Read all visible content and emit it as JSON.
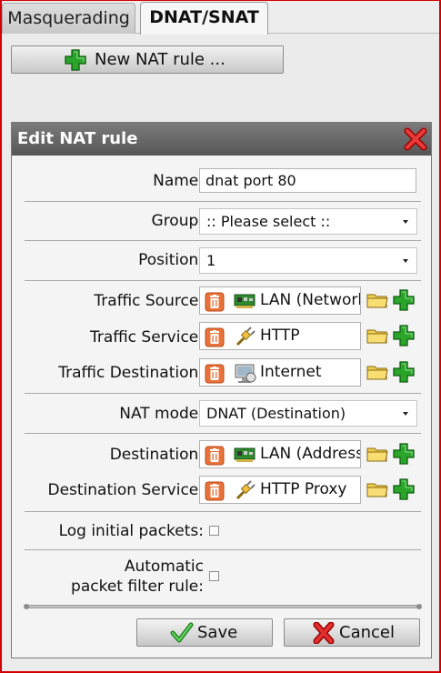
{
  "tabs": [
    {
      "label": "Masquerading",
      "active": false
    },
    {
      "label": "DNAT/SNAT",
      "active": true
    }
  ],
  "new_rule_button": {
    "label": "New NAT rule ...",
    "icon": "plus-green-icon"
  },
  "dialog": {
    "title": "Edit NAT rule",
    "name": {
      "label": "Name:",
      "value": "dnat port 80"
    },
    "group": {
      "label": "Group:",
      "value": ":: Please select ::"
    },
    "position": {
      "label": "Position:",
      "value": "1"
    },
    "traffic_source": {
      "label": "Traffic Source:",
      "value": "LAN (Network)",
      "icon": "network-card-icon"
    },
    "traffic_service": {
      "label": "Traffic Service:",
      "value": "HTTP",
      "icon": "service-plug-icon"
    },
    "traffic_destination": {
      "label": "Traffic Destination:",
      "value": "Internet",
      "icon": "internet-globe-icon"
    },
    "nat_mode": {
      "label": "NAT mode:",
      "value": "DNAT (Destination)"
    },
    "destination": {
      "label": "Destination:",
      "value": "LAN (Address)",
      "icon": "network-card-icon"
    },
    "destination_service": {
      "label": "Destination Service:",
      "value": "HTTP Proxy",
      "icon": "service-plug-icon"
    },
    "log_initial_packets": {
      "label": "Log initial packets:",
      "checked": false
    },
    "auto_filter_rule": {
      "label_line1": "Automatic",
      "label_line2": "packet filter rule:",
      "checked": false
    },
    "save_button": {
      "label": "Save",
      "icon": "checkmark-icon"
    },
    "cancel_button": {
      "label": "Cancel",
      "icon": "red-x-icon"
    }
  },
  "colors": {
    "frame_border": "#d40000",
    "title_bar": "#5e5e5e",
    "add_green": "#1e9e1e",
    "trash_orange": "#e26a2c",
    "folder_yellow": "#e9c33a"
  }
}
